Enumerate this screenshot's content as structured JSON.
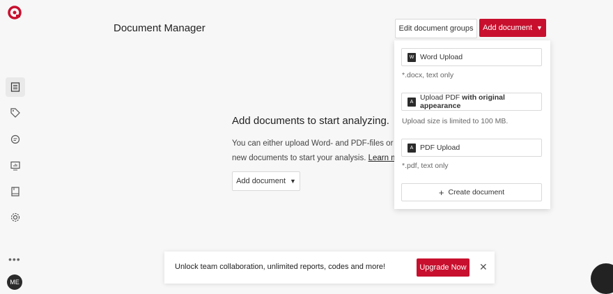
{
  "app": {
    "title": "Document Manager"
  },
  "sidebar": {
    "items": [
      {
        "icon": "document-icon"
      },
      {
        "icon": "tag-icon"
      },
      {
        "icon": "chat-icon"
      },
      {
        "icon": "presentation-chart-icon"
      },
      {
        "icon": "book-icon"
      },
      {
        "icon": "gear-icon"
      }
    ],
    "more_label": "•••",
    "avatar_initials": "ME"
  },
  "header": {
    "edit_groups_label": "Edit document groups",
    "add_document_label": "Add document",
    "chevron": "⌄"
  },
  "empty_state": {
    "title": "Add documents to start analyzing.",
    "text_before": "You can either upload Word- and PDF-files or c",
    "text_line2": "new documents to start your analysis. ",
    "link": "Learn m",
    "button_label": "Add document"
  },
  "dropdown": {
    "word_upload": {
      "label": "Word Upload",
      "note": "*.docx, text only"
    },
    "pdf_original": {
      "label_prefix": "Upload PDF ",
      "label_bold": "with original appearance",
      "note": "Upload size is limited to 100 MB."
    },
    "pdf_upload": {
      "label": "PDF Upload",
      "note": "*.pdf, text only"
    },
    "create": {
      "label": "Create document",
      "plus": "+"
    }
  },
  "banner": {
    "text": "Unlock team collaboration, unlimited reports, codes and more!",
    "button_label": "Upgrade Now",
    "close": "✕"
  },
  "colors": {
    "accent": "#c8102e",
    "background": "#f7f7f7"
  }
}
